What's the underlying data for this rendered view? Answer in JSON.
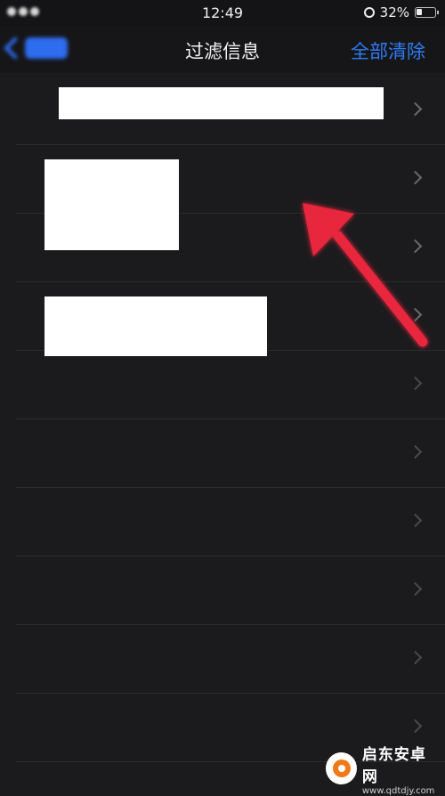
{
  "status_bar": {
    "time": "12:49",
    "battery": "32%"
  },
  "nav": {
    "title": "过滤信息",
    "right_action": "全部清除"
  },
  "list": [
    {
      "title": "",
      "sub": ""
    },
    {
      "title": "",
      "sub": ""
    },
    {
      "title": "",
      "sub": ""
    },
    {
      "title": "",
      "sub": ""
    },
    {
      "title": "",
      "sub": ""
    },
    {
      "title": "",
      "sub": ""
    },
    {
      "title": "",
      "sub": ""
    },
    {
      "title": "",
      "sub": ""
    },
    {
      "title": "",
      "sub": ""
    },
    {
      "title": "",
      "sub": ""
    }
  ],
  "watermark": {
    "name": "启东安卓网",
    "url": "www.qdtdjy.com"
  },
  "colors": {
    "accent": "#2e7cf6",
    "arrow": "#e8283c",
    "background": "#1b1b1d"
  }
}
